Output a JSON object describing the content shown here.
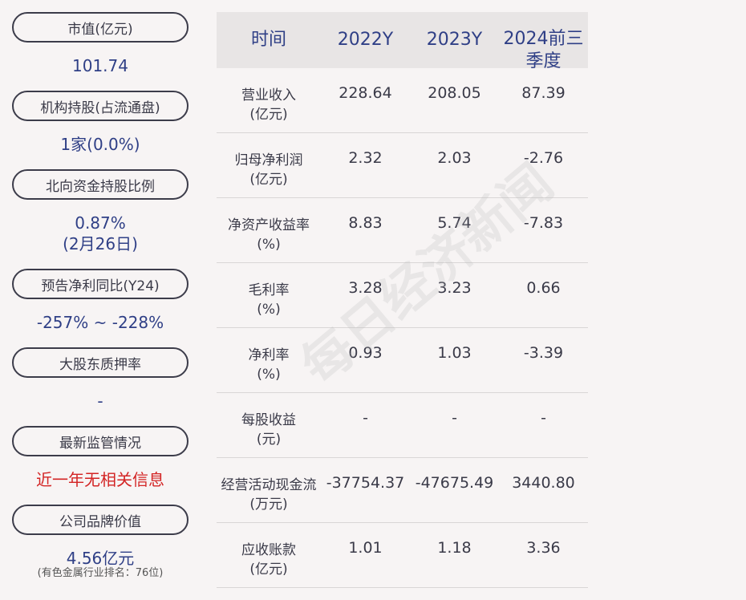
{
  "left": {
    "items": [
      {
        "label": "市值(亿元)",
        "value": "101.74",
        "value_color": "normal"
      },
      {
        "label": "机构持股(占流通盘)",
        "value": "1家(0.0%)",
        "value_color": "normal"
      },
      {
        "label": "北向资金持股比例",
        "value": "0.87%",
        "value2": "(2月26日)",
        "value_color": "normal"
      },
      {
        "label": "预告净利同比(Y24)",
        "value": "-257% ~ -228%",
        "value_color": "normal"
      },
      {
        "label": "大股东质押率",
        "value": "-",
        "value_color": "normal"
      },
      {
        "label": "最新监管情况",
        "value": "近一年无相关信息",
        "value_color": "red"
      },
      {
        "label": "公司品牌价值",
        "value": "4.56亿元",
        "note": "(有色金属行业排名：76位)",
        "value_color": "normal"
      }
    ]
  },
  "table": {
    "headers": [
      "时间",
      "2022Y",
      "2023Y",
      "2024前三",
      "季度"
    ],
    "rows": [
      {
        "label1": "营业收入",
        "label2": "(亿元)",
        "v": [
          "228.64",
          "208.05",
          "87.39"
        ]
      },
      {
        "label1": "归母净利润",
        "label2": "(亿元)",
        "v": [
          "2.32",
          "2.03",
          "-2.76"
        ]
      },
      {
        "label1": "净资产收益率",
        "label2": "(%)",
        "v": [
          "8.83",
          "5.74",
          "-7.83"
        ]
      },
      {
        "label1": "毛利率",
        "label2": "(%)",
        "v": [
          "3.28",
          "3.23",
          "0.66"
        ]
      },
      {
        "label1": "净利率",
        "label2": "(%)",
        "v": [
          "0.93",
          "1.03",
          "-3.39"
        ]
      },
      {
        "label1": "每股收益",
        "label2": "(元)",
        "v": [
          "-",
          "-",
          "-"
        ]
      },
      {
        "label1": "经营活动现金流",
        "label2": "(万元)",
        "v": [
          "-37754.37",
          "-47675.49",
          "3440.80"
        ]
      },
      {
        "label1": "应收账款",
        "label2": "(亿元)",
        "v": [
          "1.01",
          "1.18",
          "3.36"
        ]
      }
    ]
  },
  "watermark": "每日经济新闻"
}
